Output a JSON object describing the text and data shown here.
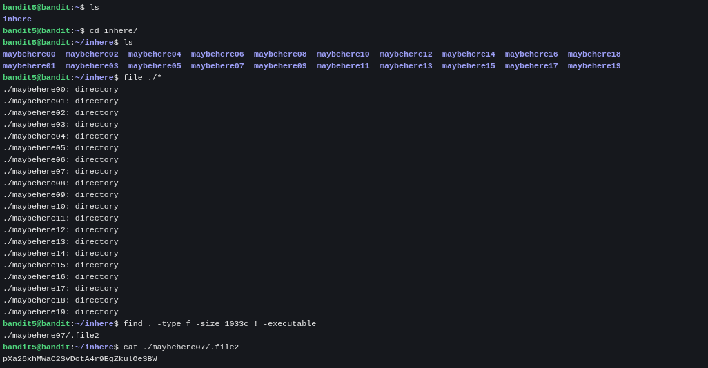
{
  "terminal": {
    "lines": [
      {
        "kind": "prompt",
        "user_host": "bandit5@bandit",
        "separator": ":",
        "path": "~",
        "symbol": "$",
        "command": "ls"
      },
      {
        "kind": "listing",
        "rows": [
          [
            "inhere"
          ]
        ]
      },
      {
        "kind": "prompt",
        "user_host": "bandit5@bandit",
        "separator": ":",
        "path": "~",
        "symbol": "$",
        "command": "cd inhere/"
      },
      {
        "kind": "prompt",
        "user_host": "bandit5@bandit",
        "separator": ":",
        "path": "~/inhere",
        "symbol": "$",
        "command": "ls"
      },
      {
        "kind": "listing",
        "rows": [
          [
            "maybehere00",
            "maybehere02",
            "maybehere04",
            "maybehere06",
            "maybehere08",
            "maybehere10",
            "maybehere12",
            "maybehere14",
            "maybehere16",
            "maybehere18"
          ],
          [
            "maybehere01",
            "maybehere03",
            "maybehere05",
            "maybehere07",
            "maybehere09",
            "maybehere11",
            "maybehere13",
            "maybehere15",
            "maybehere17",
            "maybehere19"
          ]
        ]
      },
      {
        "kind": "prompt",
        "user_host": "bandit5@bandit",
        "separator": ":",
        "path": "~/inhere",
        "symbol": "$",
        "command": "file ./*"
      },
      {
        "kind": "output",
        "text": "./maybehere00: directory"
      },
      {
        "kind": "output",
        "text": "./maybehere01: directory"
      },
      {
        "kind": "output",
        "text": "./maybehere02: directory"
      },
      {
        "kind": "output",
        "text": "./maybehere03: directory"
      },
      {
        "kind": "output",
        "text": "./maybehere04: directory"
      },
      {
        "kind": "output",
        "text": "./maybehere05: directory"
      },
      {
        "kind": "output",
        "text": "./maybehere06: directory"
      },
      {
        "kind": "output",
        "text": "./maybehere07: directory"
      },
      {
        "kind": "output",
        "text": "./maybehere08: directory"
      },
      {
        "kind": "output",
        "text": "./maybehere09: directory"
      },
      {
        "kind": "output",
        "text": "./maybehere10: directory"
      },
      {
        "kind": "output",
        "text": "./maybehere11: directory"
      },
      {
        "kind": "output",
        "text": "./maybehere12: directory"
      },
      {
        "kind": "output",
        "text": "./maybehere13: directory"
      },
      {
        "kind": "output",
        "text": "./maybehere14: directory"
      },
      {
        "kind": "output",
        "text": "./maybehere15: directory"
      },
      {
        "kind": "output",
        "text": "./maybehere16: directory"
      },
      {
        "kind": "output",
        "text": "./maybehere17: directory"
      },
      {
        "kind": "output",
        "text": "./maybehere18: directory"
      },
      {
        "kind": "output",
        "text": "./maybehere19: directory"
      },
      {
        "kind": "prompt",
        "user_host": "bandit5@bandit",
        "separator": ":",
        "path": "~/inhere",
        "symbol": "$",
        "command": "find . -type f -size 1033c ! -executable"
      },
      {
        "kind": "output",
        "text": "./maybehere07/.file2"
      },
      {
        "kind": "prompt",
        "user_host": "bandit5@bandit",
        "separator": ":",
        "path": "~/inhere",
        "symbol": "$",
        "command": "cat ./maybehere07/.file2"
      },
      {
        "kind": "output",
        "text": "pXa26xhMWaC2SvDotA4r9EgZkulOeSBW"
      }
    ]
  }
}
